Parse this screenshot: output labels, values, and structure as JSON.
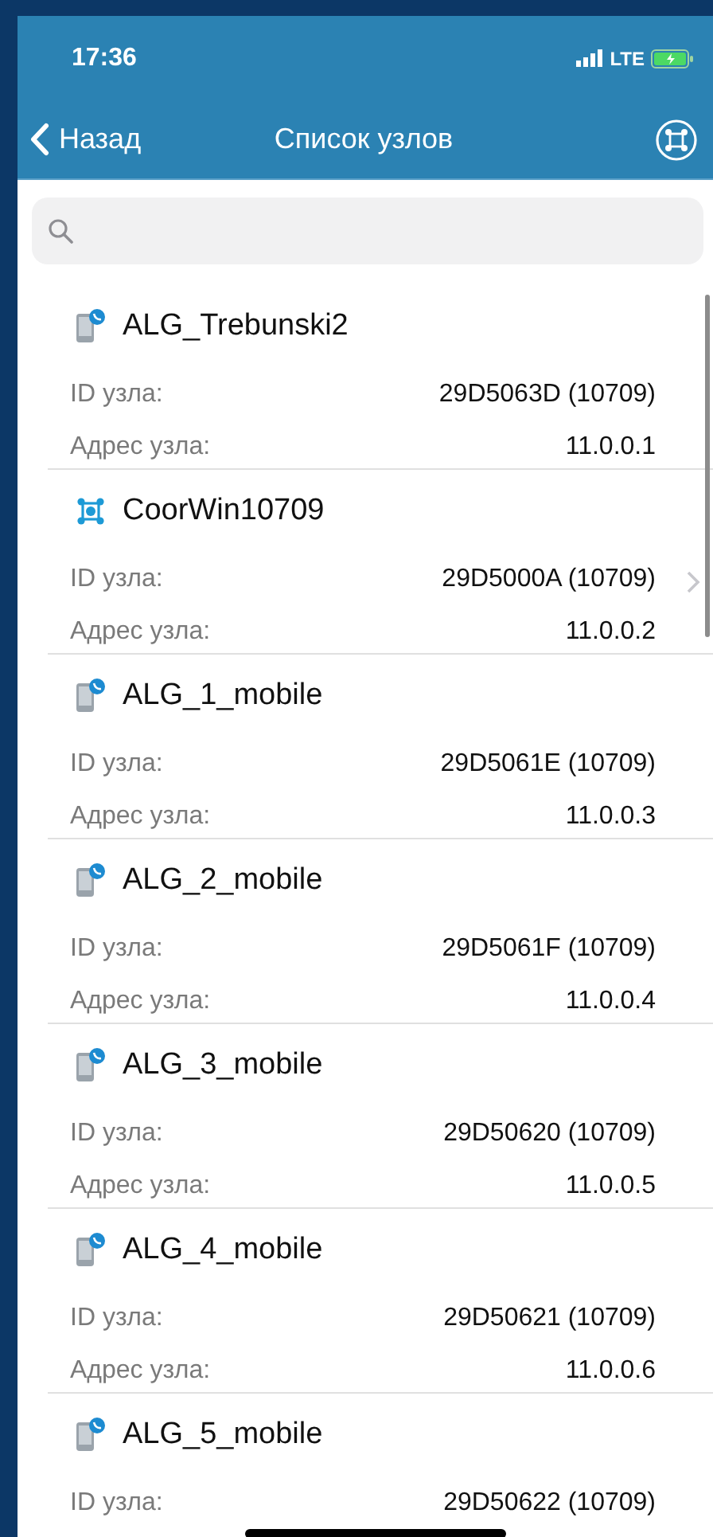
{
  "status_bar": {
    "time": "17:36",
    "network": "LTE"
  },
  "nav": {
    "back": "Назад",
    "title": "Список узлов"
  },
  "search": {
    "kind": "search"
  },
  "nodes": [
    {
      "kind": "mobile",
      "name": "ALG_Trebunski2",
      "id_label": "ID узла:",
      "id": "29D5063D (10709)",
      "addr_label": "Адрес узла:",
      "addr": "11.0.0.1",
      "disclosure": false
    },
    {
      "kind": "coordinator",
      "name": "CoorWin10709",
      "id_label": "ID узла:",
      "id": "29D5000A (10709)",
      "addr_label": "Адрес узла:",
      "addr": "11.0.0.2",
      "disclosure": true
    },
    {
      "kind": "mobile",
      "name": "ALG_1_mobile",
      "id_label": "ID узла:",
      "id": "29D5061E (10709)",
      "addr_label": "Адрес узла:",
      "addr": "11.0.0.3",
      "disclosure": false
    },
    {
      "kind": "mobile",
      "name": "ALG_2_mobile",
      "id_label": "ID узла:",
      "id": "29D5061F (10709)",
      "addr_label": "Адрес узла:",
      "addr": "11.0.0.4",
      "disclosure": false
    },
    {
      "kind": "mobile",
      "name": "ALG_3_mobile",
      "id_label": "ID узла:",
      "id": "29D50620 (10709)",
      "addr_label": "Адрес узла:",
      "addr": "11.0.0.5",
      "disclosure": false
    },
    {
      "kind": "mobile",
      "name": "ALG_4_mobile",
      "id_label": "ID узла:",
      "id": "29D50621 (10709)",
      "addr_label": "Адрес узла:",
      "addr": "11.0.0.6",
      "disclosure": false
    },
    {
      "kind": "mobile",
      "name": "ALG_5_mobile",
      "id_label": "ID узла:",
      "id": "29D50622 (10709)",
      "disclosure": false
    }
  ]
}
